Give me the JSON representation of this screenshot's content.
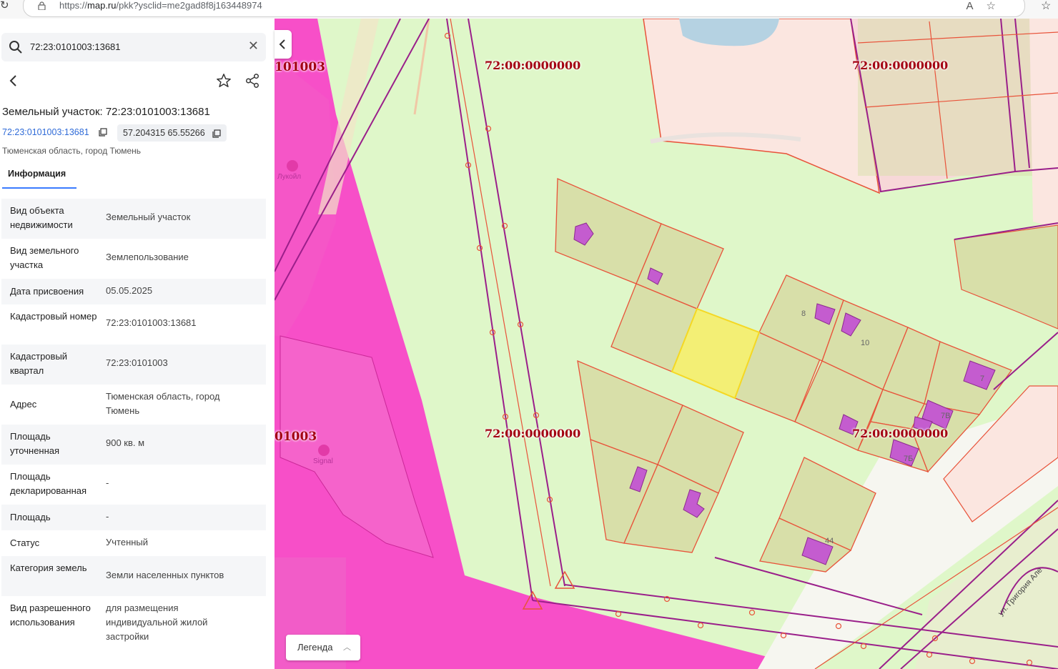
{
  "browser": {
    "url_prefix": "https://",
    "url_domain": "map.ru",
    "url_rest": "/pkk?ysclid=me2gad8f8j163448974",
    "icons": [
      "reload-icon",
      "lock-icon",
      "read-aloud-icon",
      "favorite-icon",
      "favorites-bar-icon"
    ]
  },
  "search": {
    "value": "72:23:0101003:13681",
    "icon": "search-icon",
    "clear_icon": "close-icon"
  },
  "header": {
    "title": "Земельный участок: 72:23:0101003:13681",
    "cadastral_link": "72:23:0101003:13681",
    "coordinates": "57.204315 65.55266",
    "region": "Тюменская область, город Тюмень"
  },
  "tabs": [
    {
      "label": "Информация",
      "active": true
    }
  ],
  "info_rows": [
    {
      "key": "Вид объекта недвижимости",
      "value": "Земельный участок"
    },
    {
      "key": "Вид земельного участка",
      "value": "Землепользование"
    },
    {
      "key": "Дата присвоения",
      "value": "05.05.2025"
    },
    {
      "key": "Кадастровый номер",
      "value": "72:23:0101003:13681"
    },
    {
      "key": "Кадастровый квартал",
      "value": "72:23:0101003"
    },
    {
      "key": "Адрес",
      "value": "Тюменская область, город Тюмень"
    },
    {
      "key": "Площадь уточненная",
      "value": "900 кв. м"
    },
    {
      "key": "Площадь декларированная",
      "value": "-"
    },
    {
      "key": "Площадь",
      "value": "-"
    },
    {
      "key": "Статус",
      "value": "Учтенный"
    },
    {
      "key": "Категория земель",
      "value": "Земли населенных пунктов"
    },
    {
      "key": "Вид разрешенного использования",
      "value": "для размещения индивидуальной жилой застройки"
    }
  ],
  "map": {
    "legend_label": "Легенда",
    "quarter_labels": [
      "101003",
      "72:00:0000000",
      "72:00:0000000",
      "01003",
      "72:00:0000000",
      "72:00:0000000"
    ],
    "poi_labels": [
      "Лукойл",
      "Signal"
    ],
    "plot_numbers": [
      "8",
      "10",
      "7",
      "7В",
      "7Б",
      "44"
    ],
    "street_label": "ул. Григория Але",
    "colors": {
      "zone_pink": "#f74fc8",
      "land": "#dff7c9",
      "parcel_fill": "#d8dfa9",
      "parcel_border": "#e8533a",
      "boundary": "#9a1f8a",
      "selected": "#f3ef75",
      "building": "#c45ccf",
      "quarter_label": "#a30012"
    }
  }
}
